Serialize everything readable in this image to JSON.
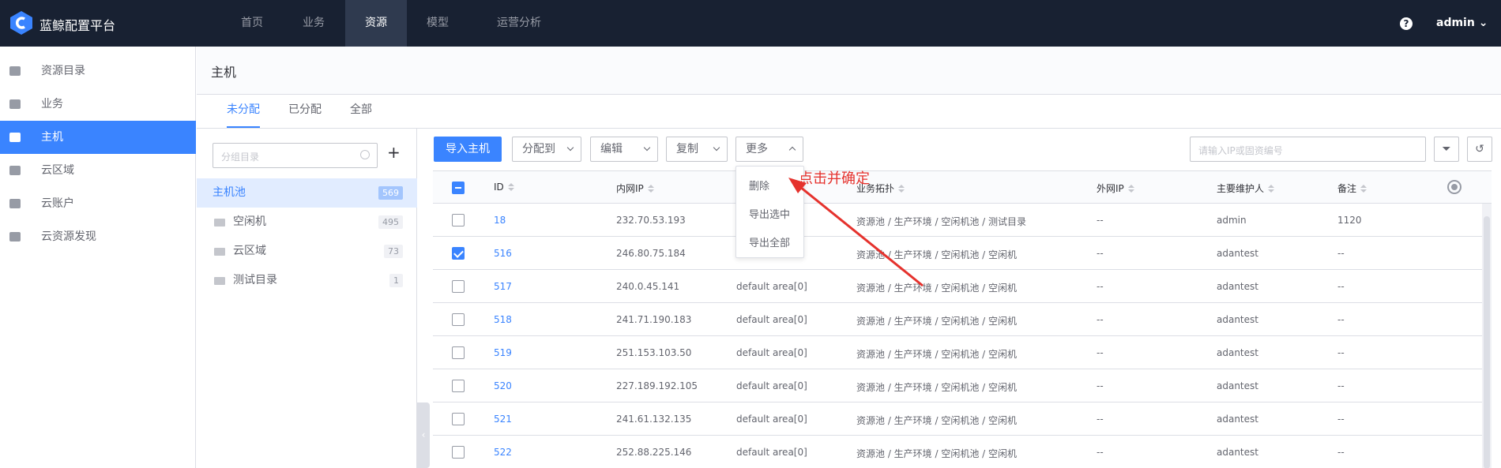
{
  "brand": {
    "title": "蓝鲸配置平台",
    "logo_color": "#3a84ff"
  },
  "topnav": {
    "items": [
      {
        "label": "首页"
      },
      {
        "label": "业务"
      },
      {
        "label": "资源"
      },
      {
        "label": "模型"
      },
      {
        "label": "运营分析"
      }
    ],
    "active": "资源",
    "help": "?",
    "user": "admin"
  },
  "sidebar": {
    "items": [
      {
        "label": "资源目录",
        "icon": "catalog-icon"
      },
      {
        "label": "业务",
        "icon": "briefcase-icon"
      },
      {
        "label": "主机",
        "icon": "host-icon"
      },
      {
        "label": "云区域",
        "icon": "cloud-area-icon"
      },
      {
        "label": "云账户",
        "icon": "cloud-account-icon"
      },
      {
        "label": "云资源发现",
        "icon": "cloud-discovery-icon"
      }
    ],
    "active": "主机"
  },
  "page": {
    "title": "主机"
  },
  "tabs": [
    {
      "label": "未分配"
    },
    {
      "label": "已分配"
    },
    {
      "label": "全部"
    }
  ],
  "directory": {
    "search_placeholder": "分组目录",
    "add": "+",
    "items": [
      {
        "name": "主机池",
        "count": "569"
      },
      {
        "name": "空闲机",
        "count": "495"
      },
      {
        "name": "云区域",
        "count": "73"
      },
      {
        "name": "测试目录",
        "count": "1"
      }
    ],
    "collapse": "‹"
  },
  "toolbar": {
    "import": "导入主机",
    "assign": "分配到",
    "edit": "编辑",
    "copy": "复制",
    "more": "更多",
    "search_placeholder": "请输入IP或固资编号"
  },
  "more_menu": {
    "items": [
      {
        "label": "删除"
      },
      {
        "label": "导出选中"
      },
      {
        "label": "导出全部"
      }
    ]
  },
  "annotation": {
    "text": "点击并确定",
    "color": "#e5322d"
  },
  "table": {
    "columns": [
      "ID",
      "内网IP",
      "业务拓扑",
      "外网IP",
      "主要维护人",
      "备注"
    ],
    "rows": [
      {
        "id": "18",
        "ip": "232.70.53.193",
        "area": "",
        "topo": "资源池 / 生产环境 / 空闲机池 / 测试目录",
        "outer_ip": "--",
        "owner": "admin",
        "note": "1120",
        "checked": false
      },
      {
        "id": "516",
        "ip": "246.80.75.184",
        "area": "",
        "topo": "资源池 / 生产环境 / 空闲机池 / 空闲机",
        "outer_ip": "--",
        "owner": "adantest",
        "note": "--",
        "checked": true
      },
      {
        "id": "517",
        "ip": "240.0.45.141",
        "area": "default area[0]",
        "topo": "资源池 / 生产环境 / 空闲机池 / 空闲机",
        "outer_ip": "--",
        "owner": "adantest",
        "note": "--",
        "checked": false
      },
      {
        "id": "518",
        "ip": "241.71.190.183",
        "area": "default area[0]",
        "topo": "资源池 / 生产环境 / 空闲机池 / 空闲机",
        "outer_ip": "--",
        "owner": "adantest",
        "note": "--",
        "checked": false
      },
      {
        "id": "519",
        "ip": "251.153.103.50",
        "area": "default area[0]",
        "topo": "资源池 / 生产环境 / 空闲机池 / 空闲机",
        "outer_ip": "--",
        "owner": "adantest",
        "note": "--",
        "checked": false
      },
      {
        "id": "520",
        "ip": "227.189.192.105",
        "area": "default area[0]",
        "topo": "资源池 / 生产环境 / 空闲机池 / 空闲机",
        "outer_ip": "--",
        "owner": "adantest",
        "note": "--",
        "checked": false
      },
      {
        "id": "521",
        "ip": "241.61.132.135",
        "area": "default area[0]",
        "topo": "资源池 / 生产环境 / 空闲机池 / 空闲机",
        "outer_ip": "--",
        "owner": "adantest",
        "note": "--",
        "checked": false
      },
      {
        "id": "522",
        "ip": "252.88.225.146",
        "area": "default area[0]",
        "topo": "资源池 / 生产环境 / 空闲机池 / 空闲机",
        "outer_ip": "--",
        "owner": "adantest",
        "note": "--",
        "checked": false
      }
    ]
  }
}
